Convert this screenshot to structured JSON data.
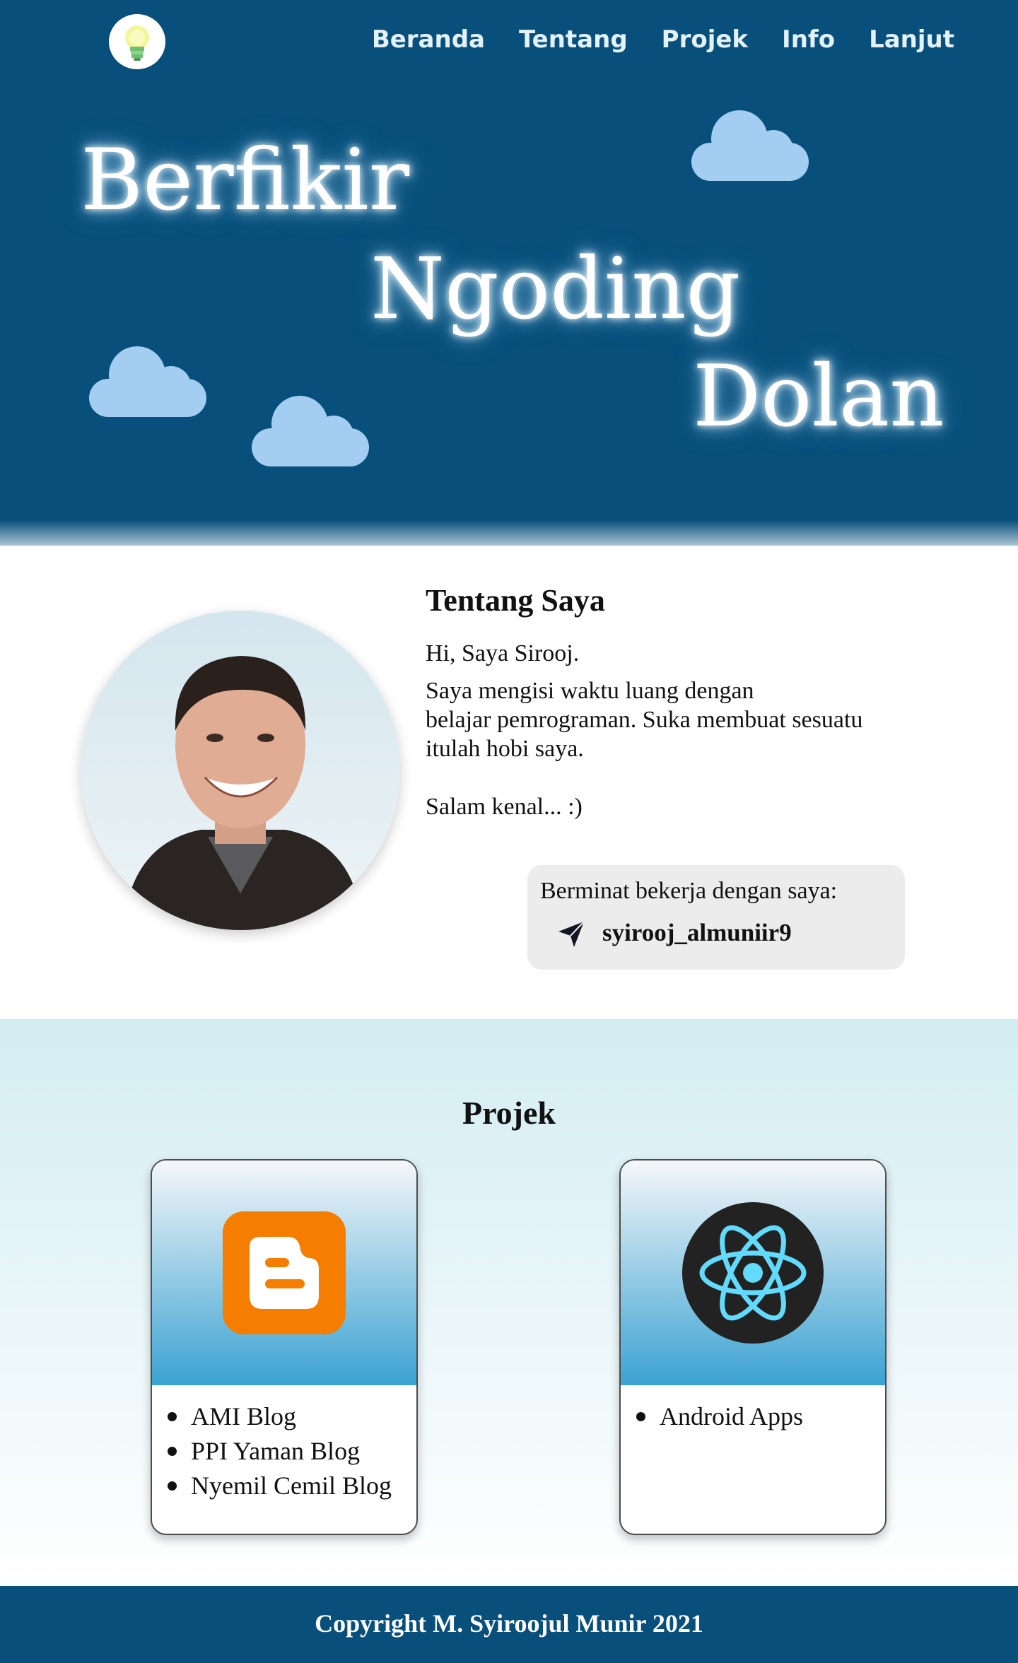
{
  "nav": {
    "items": [
      "Beranda",
      "Tentang",
      "Projek",
      "Info",
      "Lanjut"
    ]
  },
  "hero": {
    "words": [
      "Berfikir",
      "Ngoding",
      "Dolan"
    ]
  },
  "about": {
    "title": "Tentang Saya",
    "greeting": "Hi, Saya Sirooj.",
    "line1": "Saya mengisi waktu luang dengan",
    "line2": "belajar pemrograman. Suka membuat sesuatu",
    "line3": "itulah hobi saya.",
    "closing": "Salam kenal... :)",
    "contact_label": "Berminat bekerja dengan saya:",
    "contact_handle": "syirooj_almuniir9"
  },
  "projects": {
    "title": "Projek",
    "cards": [
      {
        "icon": "blogger-icon",
        "items": [
          "AMI Blog",
          "PPI Yaman Blog",
          "Nyemil Cemil Blog"
        ]
      },
      {
        "icon": "react-icon",
        "items": [
          "Android Apps"
        ]
      }
    ]
  },
  "footer": {
    "text": "Copyright M. Syiroojul Munir 2021"
  },
  "colors": {
    "primary": "#08507b",
    "cloud": "#a3cef1",
    "blogger": "#f57d00",
    "react": "#61dafb"
  }
}
